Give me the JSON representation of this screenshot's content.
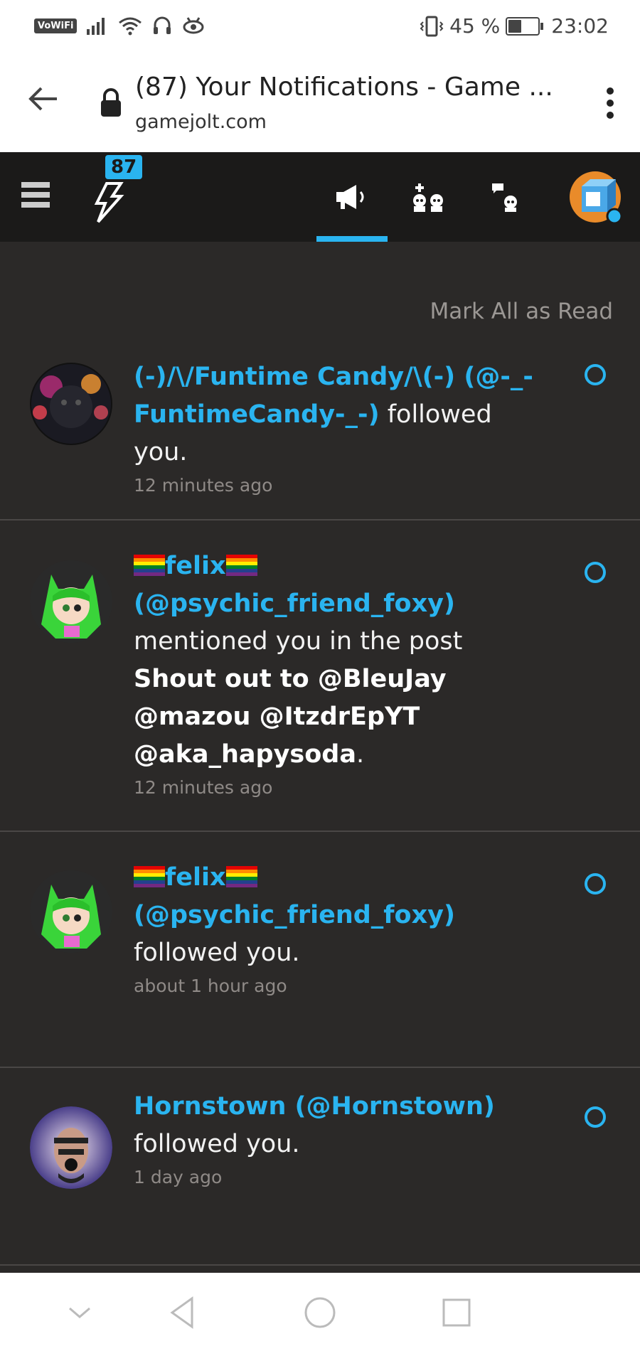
{
  "status_bar": {
    "vowifi": "VoWiFi",
    "battery_percent": "45 %",
    "battery_level": 0.45,
    "time": "23:02",
    "icons": [
      "signal-icon",
      "wifi-icon",
      "headphones-icon",
      "eye-icon",
      "vibrate-icon",
      "battery-icon"
    ]
  },
  "browser": {
    "page_title": "(87) Your Notifications - Game ...",
    "host": "gamejolt.com"
  },
  "app_bar": {
    "notification_count": "87",
    "active_tab": "activity"
  },
  "main": {
    "mark_all_read": "Mark All as Read",
    "notifications": [
      {
        "user": "(-)/\\/Funtime Candy/\\(-) (@-_-FuntimeCandy-_-)",
        "action": " followed you.",
        "time": "12 minutes ago"
      },
      {
        "user_name": "felix",
        "user_handle": "(@psychic_friend_foxy)",
        "action": "mentioned you in the post ",
        "post_title": "Shout out to @BleuJay @mazou @ItzdrEpYT @aka_hapysoda",
        "post_end": ".",
        "time": "12 minutes ago"
      },
      {
        "user_name": "felix",
        "user_handle": "(@psychic_friend_foxy)",
        "action": " followed you.",
        "time": "about 1 hour ago"
      },
      {
        "user": "Hornstown (@Hornstown)",
        "action": "followed you.",
        "time": "1 day ago"
      }
    ]
  },
  "colors": {
    "accent": "#2ab4f0",
    "background": "#2b2928",
    "appbar": "#1b1a19"
  }
}
